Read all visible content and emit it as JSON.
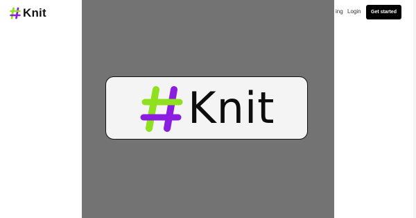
{
  "nav": {
    "brand": "Knit",
    "links": [
      "ing",
      "Login"
    ],
    "cta_label": "Get started"
  },
  "overlay": {
    "brand": "Knit"
  },
  "colors": {
    "hash_green": "#8fe01e",
    "hash_purple": "#8a1de0",
    "overlay_bg": "#737373",
    "cta_bg": "#000000"
  },
  "icons": {
    "logo": "hash-logo-icon"
  }
}
